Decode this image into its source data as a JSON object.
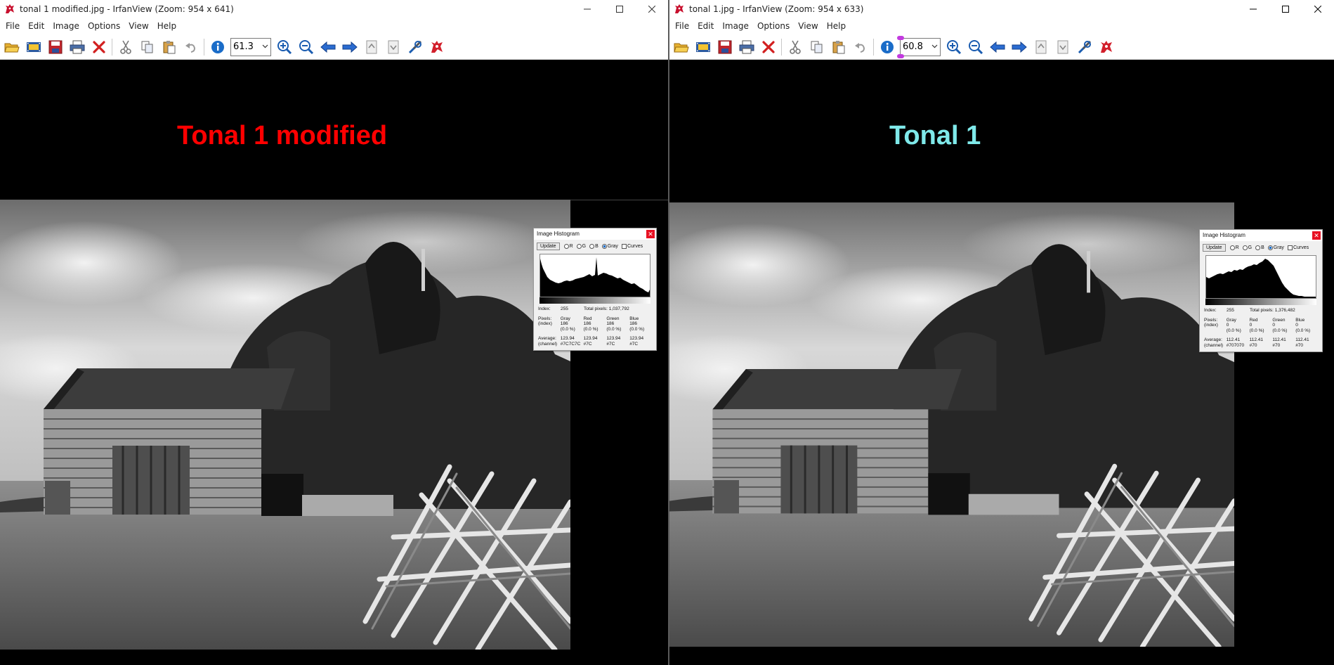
{
  "left": {
    "title": "tonal 1 modified.jpg - IrfanView (Zoom: 954 x 641)",
    "menu": [
      "File",
      "Edit",
      "Image",
      "Options",
      "View",
      "Help"
    ],
    "zoom": "61.3",
    "caption": "Tonal 1 modified",
    "caption_color": "#ff0000",
    "histogram": {
      "title": "Image Histogram",
      "update": "Update",
      "channels": [
        "R",
        "G",
        "B",
        "Gray"
      ],
      "selected": "Gray",
      "curves": "Curves",
      "index_label": "Index:",
      "index_value": "255",
      "total_label": "Total pixels:",
      "total_value": "1,037,792",
      "pixels_label": "Pixels:",
      "pixels_sub": "(index)",
      "headers": [
        "Gray",
        "Red",
        "Green",
        "Blue"
      ],
      "pixels": [
        "186",
        "186",
        "186",
        "186"
      ],
      "percents": [
        "(0.0 %)",
        "(0.0 %)",
        "(0.0 %)",
        "(0.0 %)"
      ],
      "average_label": "Average:",
      "average_sub": "(channel)",
      "averages": [
        "123.94",
        "123.94",
        "123.94",
        "123.94"
      ],
      "hex": [
        "#7C7C7C",
        "#7C",
        "#7C",
        "#7C"
      ]
    }
  },
  "right": {
    "title": "tonal 1.jpg - IrfanView (Zoom: 954 x 633)",
    "menu": [
      "File",
      "Edit",
      "Image",
      "Options",
      "View",
      "Help"
    ],
    "zoom": "60.8",
    "caption": "Tonal 1",
    "caption_color": "#7fe9ea",
    "histogram": {
      "title": "Image Histogram",
      "update": "Update",
      "channels": [
        "R",
        "G",
        "B",
        "Gray"
      ],
      "selected": "Gray",
      "curves": "Curves",
      "index_label": "Index:",
      "index_value": "255",
      "total_label": "Total pixels:",
      "total_value": "1,376,482",
      "pixels_label": "Pixels:",
      "pixels_sub": "(index)",
      "headers": [
        "Gray",
        "Red",
        "Green",
        "Blue"
      ],
      "pixels": [
        "0",
        "0",
        "0",
        "0"
      ],
      "percents": [
        "(0.0 %)",
        "(0.0 %)",
        "(0.0 %)",
        "(0.0 %)"
      ],
      "average_label": "Average:",
      "average_sub": "(channel)",
      "averages": [
        "112.41",
        "112.41",
        "112.41",
        "112.41"
      ],
      "hex": [
        "#707070",
        "#70",
        "#70",
        "#70"
      ]
    }
  },
  "toolbar_icons": [
    "open-folder-icon",
    "slideshow-icon",
    "save-icon",
    "print-icon",
    "delete-icon",
    "cut-icon",
    "copy-icon",
    "paste-icon",
    "undo-icon",
    "info-icon",
    "zoom-in-icon",
    "zoom-out-icon",
    "previous-icon",
    "next-icon",
    "page-up-icon",
    "page-down-icon",
    "settings-icon",
    "irfanview-logo-icon"
  ],
  "colors": {
    "window_bg": "#000000",
    "chrome": "#ffffff",
    "accent_blue": "#1a6cc8",
    "close_red": "#e81123",
    "zoom_handle": "#c23adf"
  }
}
